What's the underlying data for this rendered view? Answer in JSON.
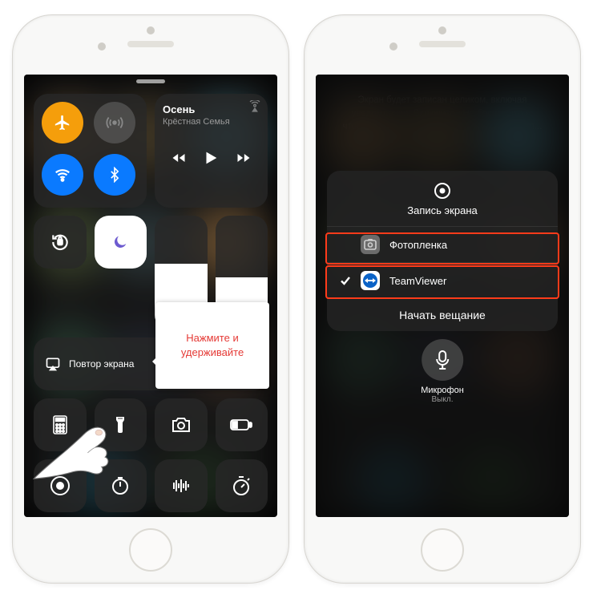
{
  "left": {
    "media": {
      "title": "Осень",
      "subtitle": "Крёстная Семья"
    },
    "mirroring_label": "Повтор экрана",
    "callout": "Нажмите и\nудерживайте",
    "brightness_pct": 58,
    "volume_pct": 46
  },
  "right": {
    "message": "Экран будет записан целиком, включая уведомления. Включите «Не беспокоить», чтобы не отображать неожиданные уведомл...",
    "sheet_title": "Запись экрана",
    "options": [
      {
        "label": "Фотопленка",
        "selected": false
      },
      {
        "label": "TeamViewer",
        "selected": true
      }
    ],
    "action_label": "Начать вещание",
    "mic": {
      "label": "Микрофон",
      "state": "Выкл."
    }
  }
}
